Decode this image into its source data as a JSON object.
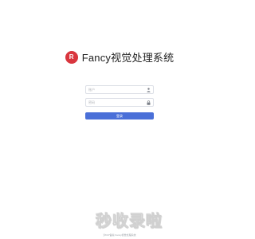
{
  "brand": {
    "logo_text": "R",
    "title": "Fancy视觉处理系统",
    "logo_color": "#d9363e"
  },
  "login": {
    "username_placeholder": "账户",
    "password_placeholder": "密码",
    "submit_label": "登录",
    "button_color": "#4a6fd8",
    "icons": {
      "username": "user-icon",
      "password": "lock-icon"
    }
  },
  "watermark": {
    "text": "秒收录啦"
  },
  "footer": {
    "text": "沪ICP备案 Fancy视觉处理系统"
  }
}
